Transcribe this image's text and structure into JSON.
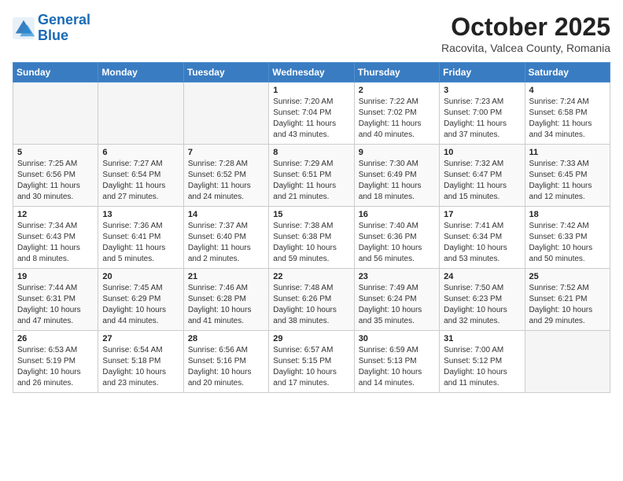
{
  "header": {
    "logo_line1": "General",
    "logo_line2": "Blue",
    "month": "October 2025",
    "location": "Racovita, Valcea County, Romania"
  },
  "weekdays": [
    "Sunday",
    "Monday",
    "Tuesday",
    "Wednesday",
    "Thursday",
    "Friday",
    "Saturday"
  ],
  "weeks": [
    [
      {
        "day": "",
        "info": ""
      },
      {
        "day": "",
        "info": ""
      },
      {
        "day": "",
        "info": ""
      },
      {
        "day": "1",
        "info": "Sunrise: 7:20 AM\nSunset: 7:04 PM\nDaylight: 11 hours\nand 43 minutes."
      },
      {
        "day": "2",
        "info": "Sunrise: 7:22 AM\nSunset: 7:02 PM\nDaylight: 11 hours\nand 40 minutes."
      },
      {
        "day": "3",
        "info": "Sunrise: 7:23 AM\nSunset: 7:00 PM\nDaylight: 11 hours\nand 37 minutes."
      },
      {
        "day": "4",
        "info": "Sunrise: 7:24 AM\nSunset: 6:58 PM\nDaylight: 11 hours\nand 34 minutes."
      }
    ],
    [
      {
        "day": "5",
        "info": "Sunrise: 7:25 AM\nSunset: 6:56 PM\nDaylight: 11 hours\nand 30 minutes."
      },
      {
        "day": "6",
        "info": "Sunrise: 7:27 AM\nSunset: 6:54 PM\nDaylight: 11 hours\nand 27 minutes."
      },
      {
        "day": "7",
        "info": "Sunrise: 7:28 AM\nSunset: 6:52 PM\nDaylight: 11 hours\nand 24 minutes."
      },
      {
        "day": "8",
        "info": "Sunrise: 7:29 AM\nSunset: 6:51 PM\nDaylight: 11 hours\nand 21 minutes."
      },
      {
        "day": "9",
        "info": "Sunrise: 7:30 AM\nSunset: 6:49 PM\nDaylight: 11 hours\nand 18 minutes."
      },
      {
        "day": "10",
        "info": "Sunrise: 7:32 AM\nSunset: 6:47 PM\nDaylight: 11 hours\nand 15 minutes."
      },
      {
        "day": "11",
        "info": "Sunrise: 7:33 AM\nSunset: 6:45 PM\nDaylight: 11 hours\nand 12 minutes."
      }
    ],
    [
      {
        "day": "12",
        "info": "Sunrise: 7:34 AM\nSunset: 6:43 PM\nDaylight: 11 hours\nand 8 minutes."
      },
      {
        "day": "13",
        "info": "Sunrise: 7:36 AM\nSunset: 6:41 PM\nDaylight: 11 hours\nand 5 minutes."
      },
      {
        "day": "14",
        "info": "Sunrise: 7:37 AM\nSunset: 6:40 PM\nDaylight: 11 hours\nand 2 minutes."
      },
      {
        "day": "15",
        "info": "Sunrise: 7:38 AM\nSunset: 6:38 PM\nDaylight: 10 hours\nand 59 minutes."
      },
      {
        "day": "16",
        "info": "Sunrise: 7:40 AM\nSunset: 6:36 PM\nDaylight: 10 hours\nand 56 minutes."
      },
      {
        "day": "17",
        "info": "Sunrise: 7:41 AM\nSunset: 6:34 PM\nDaylight: 10 hours\nand 53 minutes."
      },
      {
        "day": "18",
        "info": "Sunrise: 7:42 AM\nSunset: 6:33 PM\nDaylight: 10 hours\nand 50 minutes."
      }
    ],
    [
      {
        "day": "19",
        "info": "Sunrise: 7:44 AM\nSunset: 6:31 PM\nDaylight: 10 hours\nand 47 minutes."
      },
      {
        "day": "20",
        "info": "Sunrise: 7:45 AM\nSunset: 6:29 PM\nDaylight: 10 hours\nand 44 minutes."
      },
      {
        "day": "21",
        "info": "Sunrise: 7:46 AM\nSunset: 6:28 PM\nDaylight: 10 hours\nand 41 minutes."
      },
      {
        "day": "22",
        "info": "Sunrise: 7:48 AM\nSunset: 6:26 PM\nDaylight: 10 hours\nand 38 minutes."
      },
      {
        "day": "23",
        "info": "Sunrise: 7:49 AM\nSunset: 6:24 PM\nDaylight: 10 hours\nand 35 minutes."
      },
      {
        "day": "24",
        "info": "Sunrise: 7:50 AM\nSunset: 6:23 PM\nDaylight: 10 hours\nand 32 minutes."
      },
      {
        "day": "25",
        "info": "Sunrise: 7:52 AM\nSunset: 6:21 PM\nDaylight: 10 hours\nand 29 minutes."
      }
    ],
    [
      {
        "day": "26",
        "info": "Sunrise: 6:53 AM\nSunset: 5:19 PM\nDaylight: 10 hours\nand 26 minutes."
      },
      {
        "day": "27",
        "info": "Sunrise: 6:54 AM\nSunset: 5:18 PM\nDaylight: 10 hours\nand 23 minutes."
      },
      {
        "day": "28",
        "info": "Sunrise: 6:56 AM\nSunset: 5:16 PM\nDaylight: 10 hours\nand 20 minutes."
      },
      {
        "day": "29",
        "info": "Sunrise: 6:57 AM\nSunset: 5:15 PM\nDaylight: 10 hours\nand 17 minutes."
      },
      {
        "day": "30",
        "info": "Sunrise: 6:59 AM\nSunset: 5:13 PM\nDaylight: 10 hours\nand 14 minutes."
      },
      {
        "day": "31",
        "info": "Sunrise: 7:00 AM\nSunset: 5:12 PM\nDaylight: 10 hours\nand 11 minutes."
      },
      {
        "day": "",
        "info": ""
      }
    ]
  ]
}
